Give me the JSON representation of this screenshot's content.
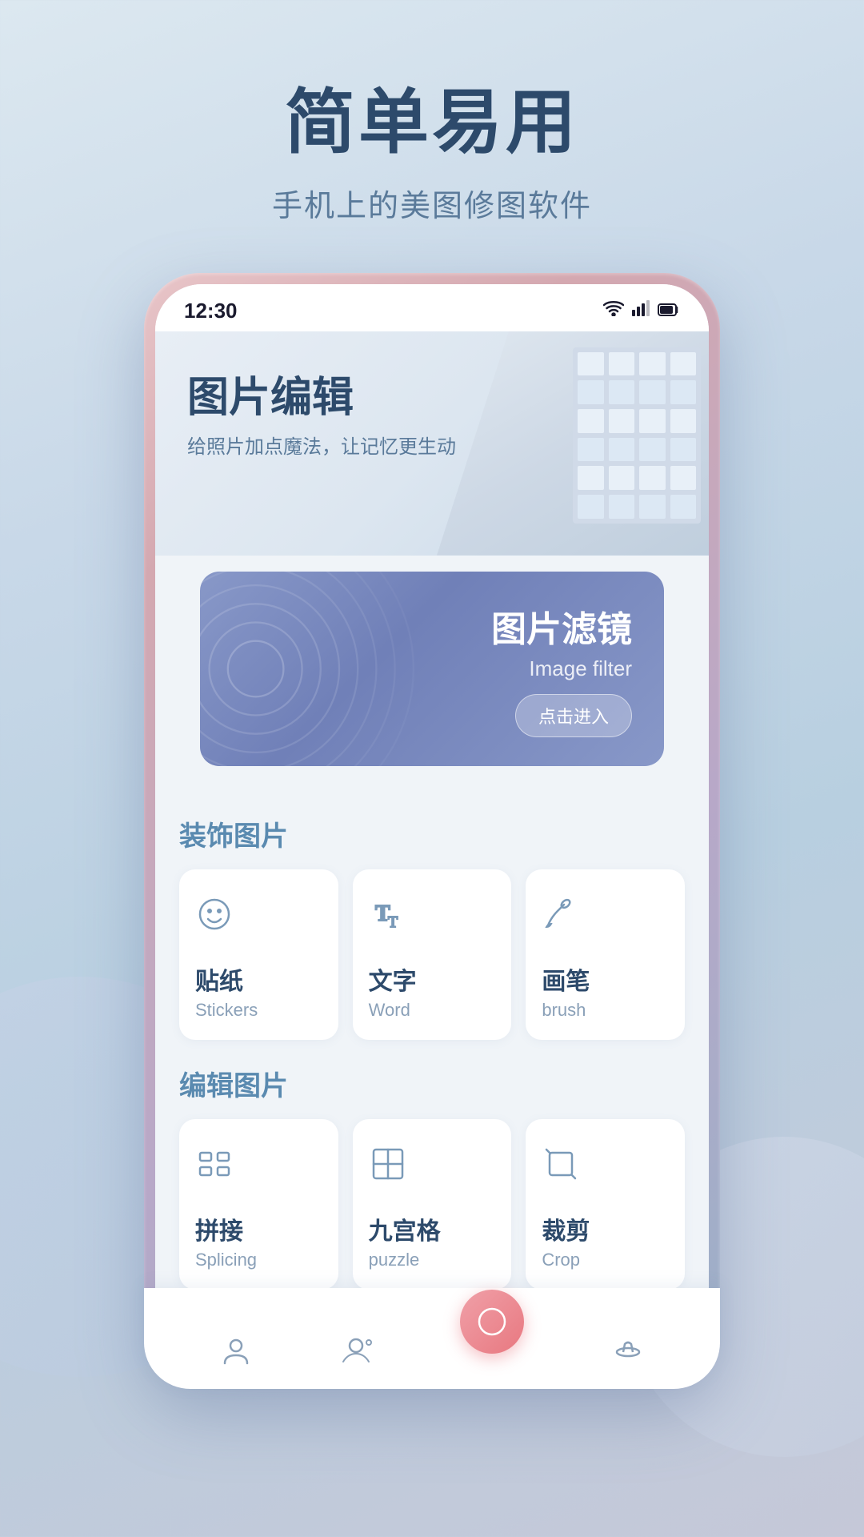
{
  "app": {
    "title": "简单易用",
    "subtitle": "手机上的美图修图软件"
  },
  "status_bar": {
    "time": "12:30",
    "wifi_icon": "wifi",
    "signal_icon": "signal",
    "battery_icon": "battery"
  },
  "hero": {
    "title": "图片编辑",
    "description": "给照片加点魔法，让记忆更生动"
  },
  "filter_card": {
    "title": "图片滤镜",
    "subtitle": "Image filter",
    "button_label": "点击进入"
  },
  "section_decorate": {
    "label_cn": "装饰",
    "label_cn2": "图片"
  },
  "section_edit": {
    "label_cn": "编辑",
    "label_cn2": "图片"
  },
  "decorate_items": [
    {
      "icon": "sticker",
      "name_cn": "贴纸",
      "name_en": "Stickers"
    },
    {
      "icon": "text",
      "name_cn": "文字",
      "name_en": "Word"
    },
    {
      "icon": "brush",
      "name_cn": "画笔",
      "name_en": "brush"
    }
  ],
  "edit_items": [
    {
      "icon": "splice",
      "name_cn": "拼接",
      "name_en": "Splicing"
    },
    {
      "icon": "puzzle",
      "name_cn": "九宫格",
      "name_en": "puzzle"
    },
    {
      "icon": "crop",
      "name_cn": "裁剪",
      "name_en": "Crop"
    }
  ],
  "bottom_nav": [
    {
      "icon": "person",
      "label": "me"
    },
    {
      "icon": "camera",
      "label": "camera"
    },
    {
      "icon": "add",
      "label": "add"
    },
    {
      "icon": "hat",
      "label": "hat"
    }
  ]
}
